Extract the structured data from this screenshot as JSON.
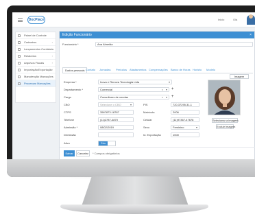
{
  "app": {
    "logo_text": "DocPlace",
    "top_right": [
      "Inicio",
      "Olá"
    ]
  },
  "sidebar": {
    "items": [
      {
        "label": "Painel de Controle",
        "chevron": ""
      },
      {
        "label": "Cadastros",
        "chevron": "›"
      },
      {
        "label": "Lançamentos Contábeis",
        "chevron": "›"
      },
      {
        "label": "Relatórios",
        "chevron": "›"
      },
      {
        "label": "Arquivos Fiscais",
        "chevron": "›"
      },
      {
        "label": "Importação/Exportação",
        "chevron": "›"
      },
      {
        "label": "Manutenção Marcações",
        "chevron": ""
      },
      {
        "label": "Processar Marcações",
        "chevron": ""
      }
    ]
  },
  "modal": {
    "title": "Edição Funcionário",
    "close": "×",
    "funcionario_label": "Funcionário *",
    "funcionario_value": "Ana Almeida",
    "tabs": [
      "Dados pessoais",
      "Contato",
      "Jornadas",
      "Períodos",
      "Afastamentos",
      "Compensações",
      "Banco de Horas",
      "Horário",
      "Modelo"
    ],
    "fields": {
      "empresa": {
        "label": "Empresa *",
        "value": "Inova e Renova Tecnologia Ltda"
      },
      "departamento": {
        "label": "Departamento *",
        "value": "Comercial"
      },
      "cargo": {
        "label": "Cargo",
        "value": "Consultores de vendas"
      },
      "cbo": {
        "label": "CBO",
        "value": "Selecione o CBO"
      },
      "pis": {
        "label": "PIS",
        "value": "720.37295.31-1"
      },
      "ctps": {
        "label": "CTPS",
        "value": "3567873.18787"
      },
      "matricula": {
        "label": "Matrícula",
        "value": "2006"
      },
      "telefone": {
        "label": "Telefone",
        "value": "(11)2787-4870"
      },
      "celular": {
        "label": "Celular",
        "value": "(11)97367-47678"
      },
      "admissao": {
        "label": "Admissão *",
        "value": "08/02/2019"
      },
      "sexo": {
        "label": "Sexo",
        "value": "Feminino"
      },
      "demissao": {
        "label": "Demissão",
        "value": ""
      },
      "id_exportacao": {
        "label": "Id. Exportação",
        "value": "1000"
      },
      "ativo": {
        "label": "Ativo",
        "value": "Sim"
      }
    },
    "photo": {
      "label": "Imagem",
      "select_button": "Selecionar a imagem",
      "delete_button": "Excluir imagem"
    },
    "footer": {
      "save": "Salvar",
      "cancel": "Cancelar",
      "required_note": "* Campos obrigatórios"
    }
  }
}
